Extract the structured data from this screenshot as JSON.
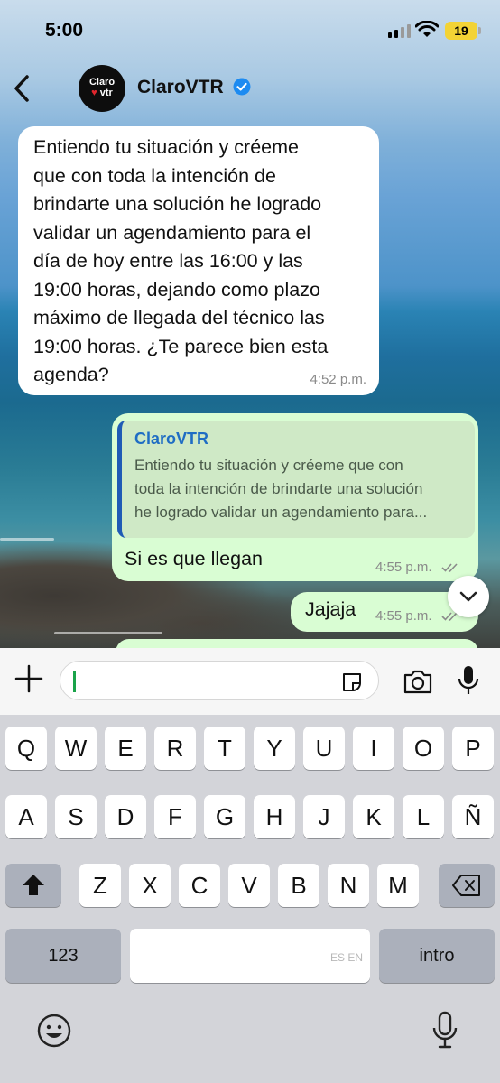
{
  "status_bar": {
    "time": "5:00",
    "battery": "19"
  },
  "header": {
    "contact_name": "ClaroVTR",
    "avatar_text_top": "Claro",
    "avatar_text_bottom": "vtr"
  },
  "messages": [
    {
      "direction": "incoming",
      "lines": [
        "Entiendo tu situación y créeme",
        "que con toda la intención de",
        "brindarte una solución he logrado",
        "validar un agendamiento para el",
        "día de hoy entre las 16:00 y las",
        "19:00 horas, dejando como plazo",
        "máximo de llegada del técnico las",
        "19:00 horas. ¿Te parece bien esta",
        "agenda?"
      ],
      "time": "4:52 p.m."
    },
    {
      "direction": "outgoing",
      "quote_author": "ClaroVTR",
      "quote_lines": [
        "Entiendo tu situación y créeme que con",
        "toda la intención de brindarte una solución",
        "he logrado validar un agendamiento para..."
      ],
      "text": "Si es que llegan",
      "time": "4:55 p.m."
    },
    {
      "direction": "outgoing",
      "text": "Jajaja",
      "time": "4:55 p.m."
    }
  ],
  "input": {
    "value": "",
    "placeholder": ""
  },
  "keyboard": {
    "row1": [
      "Q",
      "W",
      "E",
      "R",
      "T",
      "Y",
      "U",
      "I",
      "O",
      "P"
    ],
    "row2": [
      "A",
      "S",
      "D",
      "F",
      "G",
      "H",
      "J",
      "K",
      "L",
      "Ñ"
    ],
    "row3": [
      "Z",
      "X",
      "C",
      "V",
      "B",
      "N",
      "M"
    ],
    "numbers_key": "123",
    "return_key": "intro",
    "space_hint": "ES EN"
  },
  "colors": {
    "outgoing_bubble": "#d9fdd3",
    "incoming_bubble": "#ffffff",
    "verified": "#1d8bf1",
    "quote_accent": "#1f5bb5"
  },
  "icons": [
    "back-icon",
    "verified-icon",
    "plus-icon",
    "sticker-icon",
    "camera-icon",
    "mic-icon",
    "chevron-down-icon",
    "shift-icon",
    "delete-icon",
    "emoji-icon",
    "dictation-icon"
  ]
}
